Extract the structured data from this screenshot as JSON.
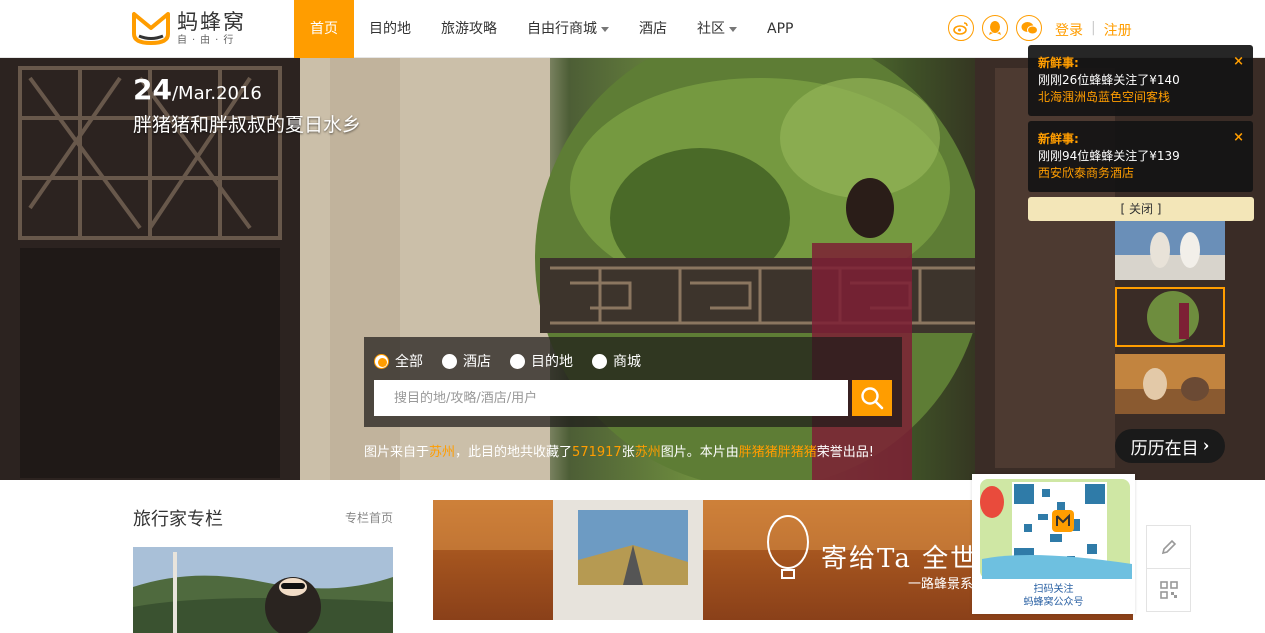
{
  "brand": {
    "name": "蚂蜂窝",
    "sub": "自·由·行",
    "accent": "#ff9d00"
  },
  "nav": {
    "items": [
      {
        "label": "首页",
        "active": true,
        "dropdown": false
      },
      {
        "label": "目的地",
        "active": false,
        "dropdown": false
      },
      {
        "label": "旅游攻略",
        "active": false,
        "dropdown": false
      },
      {
        "label": "自由行商城",
        "active": false,
        "dropdown": true
      },
      {
        "label": "酒店",
        "active": false,
        "dropdown": false
      },
      {
        "label": "社区",
        "active": false,
        "dropdown": true
      },
      {
        "label": "APP",
        "active": false,
        "dropdown": false
      }
    ],
    "social_icons": [
      "weibo-icon",
      "qq-icon",
      "wechat-icon"
    ],
    "login": "登录",
    "register": "注册"
  },
  "hero": {
    "day": "24",
    "month_year": "/Mar.2016",
    "title": "胖猪猪和胖叔叔的夏日水乡",
    "search": {
      "options": [
        "全部",
        "酒店",
        "目的地",
        "商城"
      ],
      "selected": "全部",
      "placeholder": "搜目的地/攻略/酒店/用户"
    },
    "caption": {
      "p1": "图片来自于",
      "place": "苏州",
      "p2": "，此目的地共收藏了",
      "count": "571917",
      "p3": "张",
      "place2": "苏州",
      "p4": "图片。本片由",
      "author": "胖猪猪胖猪猪",
      "p5": "荣誉出品!"
    },
    "lili": "历历在目"
  },
  "notifications": [
    {
      "title": "新鲜事:",
      "text": "刚刚26位蜂蜂关注了¥140",
      "link": "北海涠洲岛蓝色空间客栈"
    },
    {
      "title": "新鲜事:",
      "text": "刚刚94位蜂蜂关注了¥139",
      "link": "西安欣泰商务酒店"
    }
  ],
  "close_all": "[ 关闭 ]",
  "column": {
    "title": "旅行家专栏",
    "link": "专栏首页"
  },
  "banner": {
    "title": "寄给Ta 全世界的",
    "sub": "一路蜂景系"
  },
  "qr": {
    "line1": "扫码关注",
    "line2": "蚂蜂窝公众号"
  }
}
